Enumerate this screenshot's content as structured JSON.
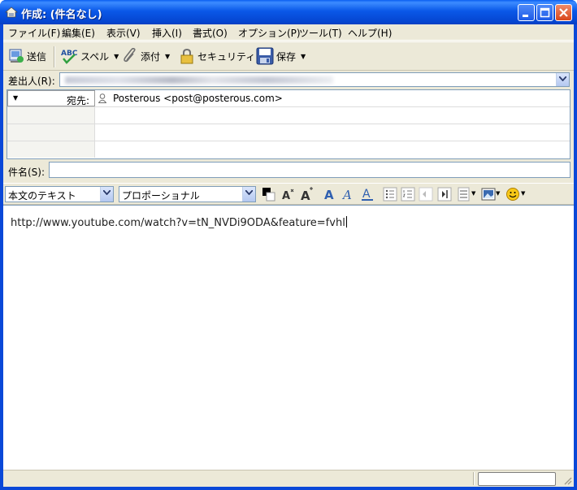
{
  "window": {
    "title": "作成: (件名なし)"
  },
  "menu": {
    "items": [
      "ファイル(F)",
      "編集(E)",
      "表示(V)",
      "挿入(I)",
      "書式(O)",
      "オプション(P)",
      "ツール(T)",
      "ヘルプ(H)"
    ]
  },
  "toolbar": {
    "send_label": "送信",
    "spell_label": "スペル",
    "attach_label": "添付",
    "security_label": "セキュリティ",
    "save_label": "保存"
  },
  "header": {
    "from_label": "差出人(R):",
    "to_type_label": "宛先:",
    "to_value": "Posterous <post@posterous.com>",
    "subject_label": "件名(S):",
    "subject_value": ""
  },
  "format": {
    "paragraph_style": "本文のテキスト",
    "font_name": "プロポーショナル"
  },
  "body": {
    "text": "http://www.youtube.com/watch?v=tN_NVDi9ODA&feature=fvhl"
  },
  "colors": {
    "titlebar": "#0a58e8",
    "chrome": "#ece9d8",
    "close_button": "#d8461c"
  }
}
